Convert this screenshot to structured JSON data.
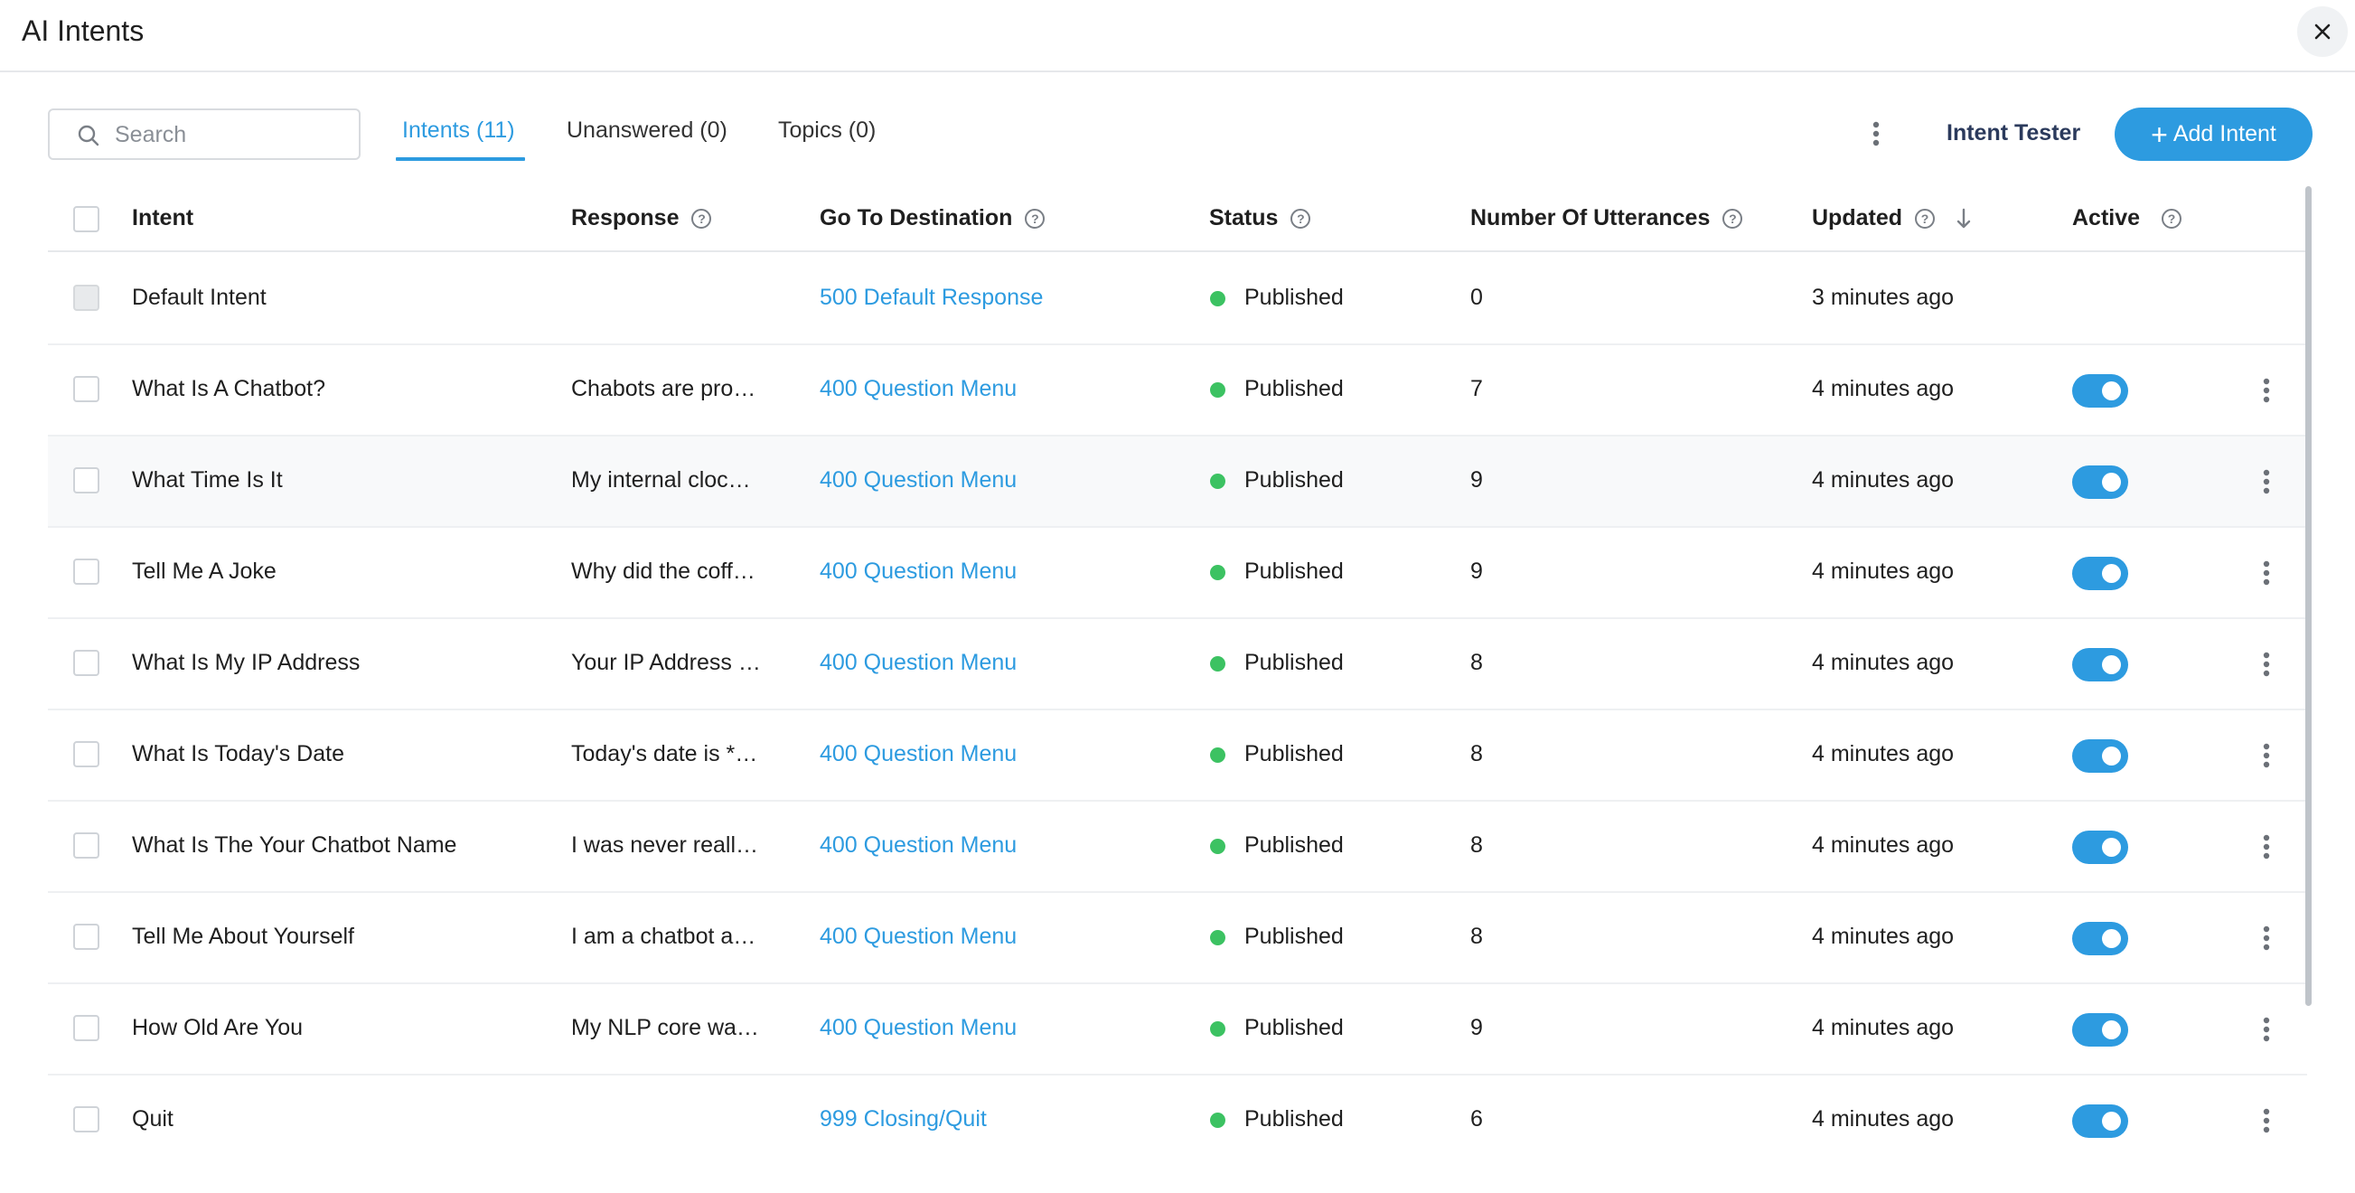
{
  "header": {
    "title": "AI Intents"
  },
  "search": {
    "placeholder": "Search"
  },
  "tabs": [
    {
      "label": "Intents (11)",
      "active": true
    },
    {
      "label": "Unanswered (0)",
      "active": false
    },
    {
      "label": "Topics (0)",
      "active": false
    }
  ],
  "toolbar": {
    "intent_tester_label": "Intent Tester",
    "add_intent_label": "Add Intent",
    "add_intent_icon": "plus-icon"
  },
  "columns": {
    "intent": "Intent",
    "response": "Response",
    "destination": "Go To Destination",
    "status": "Status",
    "utterances": "Number Of Utterances",
    "updated": "Updated",
    "active": "Active"
  },
  "rows": [
    {
      "intent": "Default Intent",
      "response": "",
      "destination": "500 Default Response",
      "status": "Published",
      "utterances": "0",
      "updated": "3 minutes ago",
      "active": null
    },
    {
      "intent": "What Is A Chatbot?",
      "response": "Chabots are pro…",
      "destination": "400 Question Menu",
      "status": "Published",
      "utterances": "7",
      "updated": "4 minutes ago",
      "active": true
    },
    {
      "intent": "What Time Is It",
      "response": "My internal cloc…",
      "destination": "400 Question Menu",
      "status": "Published",
      "utterances": "9",
      "updated": "4 minutes ago",
      "active": true
    },
    {
      "intent": "Tell Me A Joke",
      "response": "Why did the coff…",
      "destination": "400 Question Menu",
      "status": "Published",
      "utterances": "9",
      "updated": "4 minutes ago",
      "active": true
    },
    {
      "intent": "What Is My IP Address",
      "response": "Your IP Address …",
      "destination": "400 Question Menu",
      "status": "Published",
      "utterances": "8",
      "updated": "4 minutes ago",
      "active": true
    },
    {
      "intent": "What Is Today's Date",
      "response": "Today's date is *…",
      "destination": "400 Question Menu",
      "status": "Published",
      "utterances": "8",
      "updated": "4 minutes ago",
      "active": true
    },
    {
      "intent": "What Is The Your Chatbot Name",
      "response": "I was never reall…",
      "destination": "400 Question Menu",
      "status": "Published",
      "utterances": "8",
      "updated": "4 minutes ago",
      "active": true
    },
    {
      "intent": "Tell Me About Yourself",
      "response": "I am a chatbot a…",
      "destination": "400 Question Menu",
      "status": "Published",
      "utterances": "8",
      "updated": "4 minutes ago",
      "active": true
    },
    {
      "intent": "How Old Are You",
      "response": "My NLP core wa…",
      "destination": "400 Question Menu",
      "status": "Published",
      "utterances": "9",
      "updated": "4 minutes ago",
      "active": true
    },
    {
      "intent": "Quit",
      "response": "",
      "destination": "999 Closing/Quit",
      "status": "Published",
      "utterances": "6",
      "updated": "4 minutes ago",
      "active": true
    }
  ],
  "colors": {
    "accent": "#2d9be0",
    "status_published": "#3cc262",
    "heading": "#2b3a5c"
  }
}
